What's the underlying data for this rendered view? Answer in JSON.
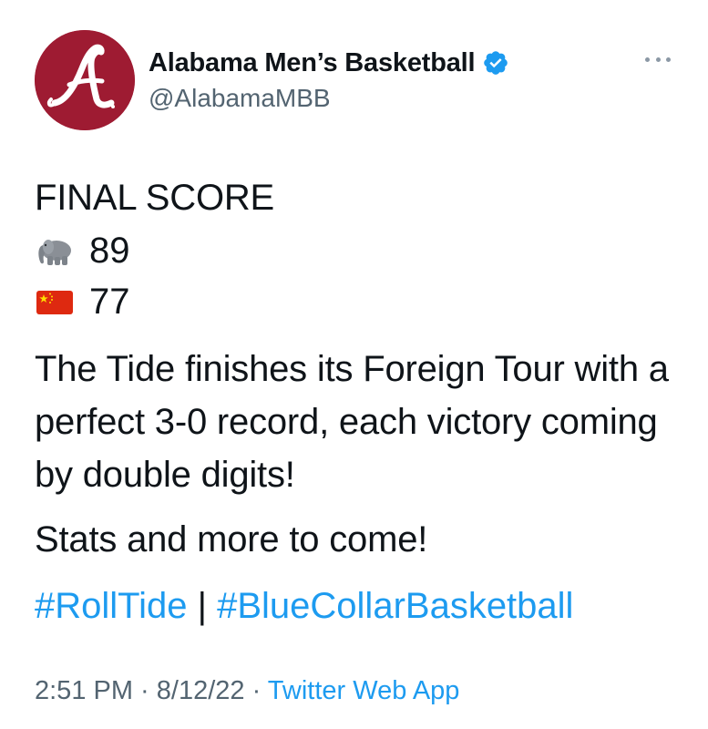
{
  "tweet": {
    "author": {
      "display_name": "Alabama Men’s Basketball",
      "handle": "@AlabamaMBB",
      "verified": true,
      "avatar_letter": "A",
      "avatar_color": "#9e1b32"
    },
    "more_icon": "more-horizontal-icon",
    "score": {
      "heading": "FINAL SCORE",
      "teams": [
        {
          "icon": "elephant-emoji",
          "value": "89"
        },
        {
          "icon": "china-flag-emoji",
          "value": "77"
        }
      ]
    },
    "paragraph": "The Tide finishes its Foreign Tour with a perfect 3-0 record, each victory coming by double digits!",
    "paragraph2": "Stats and more to come!",
    "hashtags": [
      "#RollTide",
      "#BlueCollarBasketball"
    ],
    "hashtag_separator": " | ",
    "meta": {
      "time": "2:51 PM",
      "dot": " · ",
      "date": "8/12/22",
      "app": "Twitter Web App"
    },
    "colors": {
      "link": "#1d9bf0",
      "text": "#0f1419",
      "muted": "#536471"
    }
  }
}
